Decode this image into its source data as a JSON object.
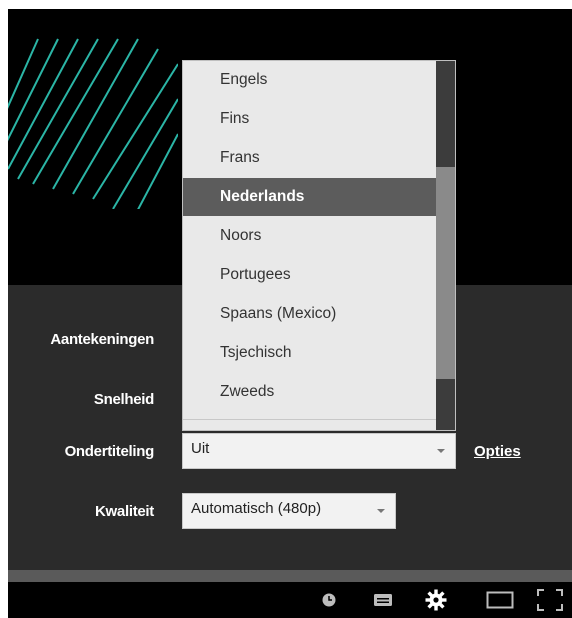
{
  "settings": {
    "annotations_label": "Aantekeningen",
    "speed_label": "Snelheid",
    "subtitles_label": "Ondertiteling",
    "quality_label": "Kwaliteit"
  },
  "subtitles": {
    "selected_value": "Uit",
    "options_link": "Opties"
  },
  "quality": {
    "selected_value": "Automatisch (480p)"
  },
  "dropdown": {
    "items": [
      "Engels",
      "Fins",
      "Frans",
      "Nederlands",
      "Noors",
      "Portugees",
      "Spaans (Mexico)",
      "Tsjechisch",
      "Zweeds"
    ],
    "highlighted": "Nederlands"
  },
  "controls": {
    "icons": [
      "clock-icon",
      "subtitles-icon",
      "settings-gear-icon",
      "theater-mode-icon",
      "fullscreen-icon"
    ]
  },
  "colors": {
    "stripe": "#2bb5a6",
    "panel": "#2b2b2b",
    "highlight": "#5c5c5c"
  }
}
